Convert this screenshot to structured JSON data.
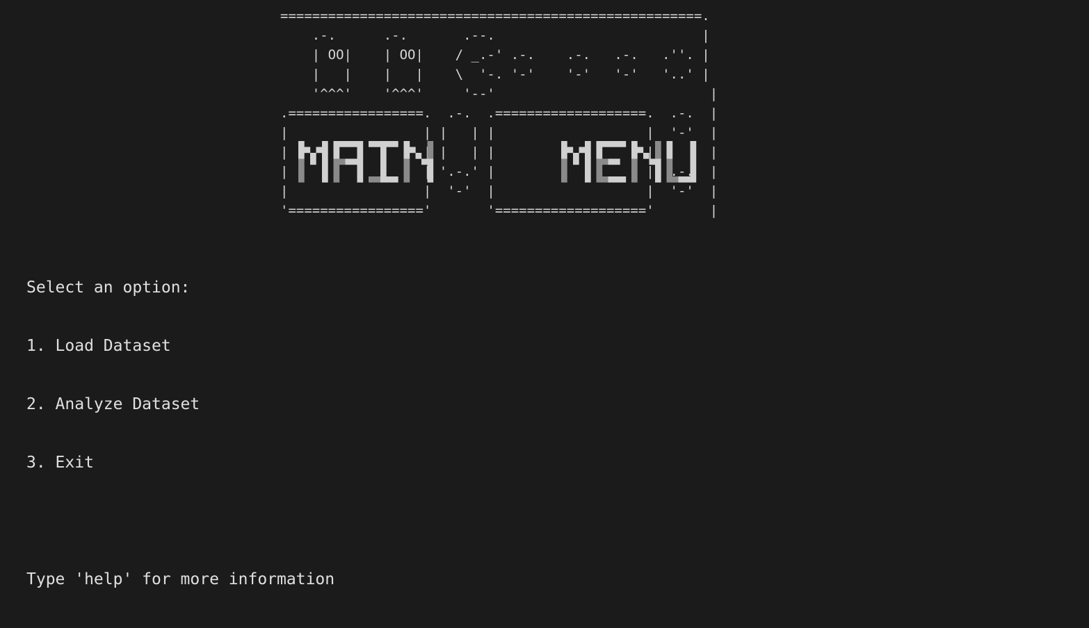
{
  "terminal": {
    "background": "#1b1b1b",
    "foreground": "#d7d7d7",
    "banner": {
      "words": [
        "MAIN",
        "MENU"
      ],
      "fill_color": "#d0d0d0",
      "shade_color": "#8a8a8a",
      "art_lines": [
        "=====================================================.",
        "    .-.      .-.       .--.                          |",
        "    | OO|    | OO|    / _.-' .-.    .-.   .-.   .''. |",
        "    |   |    |   |    \\  '-. '-'    '-'   '-'   '..' |",
        "    '^^^'    '^^^'     '--'                           |",
        ".=================.  .-.  .===================.  .-.  |",
        "|                 | |   | |                   |  '-'  |",
        "|                 | |   | |                   |       |",
        "|                 | '.-.' |                   |  .-.  |",
        "|                 |  '-'  |                   |  '-'  |",
        "'================='       '==================='       |"
      ]
    },
    "menu": {
      "prompt": "Select an option:",
      "options": [
        "1. Load Dataset",
        "2. Analyze Dataset",
        "3. Exit"
      ],
      "hint": "Type 'help' for more information"
    }
  }
}
